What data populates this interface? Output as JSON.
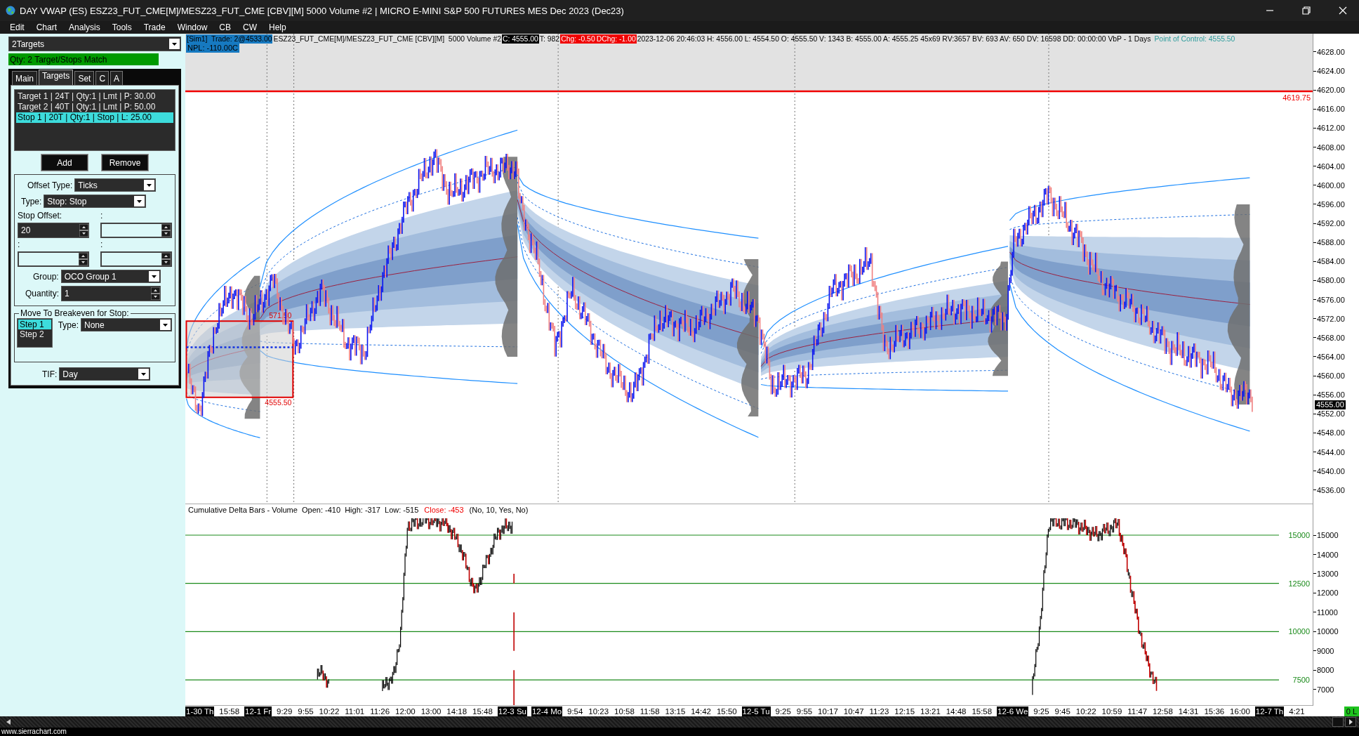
{
  "window": {
    "title": "DAY VWAP (ES) ESZ23_FUT_CME[M]/MESZ23_FUT_CME [CBV][M]  5000 Volume #2 | MICRO E-MINI S&P 500 FUTURES MES Dec 2023 (Dec23)"
  },
  "menu": [
    "Edit",
    "Chart",
    "Analysis",
    "Tools",
    "Trade",
    "Window",
    "CB",
    "CW",
    "Help"
  ],
  "order_panel": {
    "preset": "2Targets",
    "status": "Qty: 2 Target/Stops Match",
    "tabs": [
      {
        "label": "Main",
        "selected": false
      },
      {
        "label": "Targets",
        "selected": true
      },
      {
        "label": "Set",
        "selected": false
      },
      {
        "label": "C",
        "selected": false
      },
      {
        "label": "A",
        "selected": false
      }
    ],
    "orders": [
      {
        "text": "Target 1 | 24T | Qty:1 | Lmt | P: 30.00",
        "selected": false
      },
      {
        "text": "Target 2 | 40T | Qty:1 | Lmt | P: 50.00",
        "selected": false
      },
      {
        "text": "Stop 1 | 20T | Qty:1 | Stop | L: 25.00",
        "selected": true
      }
    ],
    "buttons": [
      "Add",
      "Remove"
    ],
    "offset_type": {
      "label": "Offset Type:",
      "value": "Ticks"
    },
    "type": {
      "label": "Type:",
      "value": "Stop: Stop"
    },
    "offset_fields": [
      {
        "label": "Stop Offset:",
        "value": "20",
        "disabled": false
      },
      {
        "label": ":",
        "disabled": true
      },
      {
        "label": ":",
        "disabled": true
      },
      {
        "label": ":",
        "disabled": true
      }
    ],
    "group": {
      "label": "Group:",
      "value": "OCO Group 1"
    },
    "quantity": {
      "label": "Quantity:",
      "value": "1"
    },
    "breakeven": {
      "title": "Move To Breakeven for Stop:",
      "steps": [
        {
          "label": "Step 1",
          "selected": true
        },
        {
          "label": "Step 2",
          "selected": false
        }
      ],
      "type_label": "Type:",
      "type_value": "None"
    },
    "tif": {
      "label": "TIF:",
      "value": "Day"
    }
  },
  "chart": {
    "header": [
      {
        "text": "[Sim1]  Trade: 2@4533.00",
        "kind": "trade"
      },
      {
        "text": "ESZ23_FUT_CME[M]/MESZ23_FUT_CME [CBV][M]  5000 Volume #2",
        "kind": "plain"
      },
      {
        "text": "C: 4555.00",
        "kind": "inverse"
      },
      {
        "text": "T: 982",
        "kind": "plain"
      },
      {
        "text": "Chg: -0.50",
        "kind": "alert"
      },
      {
        "text": "DChg: -1.00",
        "kind": "alert"
      },
      {
        "text": "2023-12-06 20:46:03 H: 4556.00 L: 4554.50 O: 4555.50 V: 1343 B: 4555.00 A: 4555.25 45x69 RV:3657 BV: 693 AV: 650 DV: 16598 DD: 00:00:00 VbP - 1 Days",
        "kind": "plain"
      },
      {
        "text": "Point of Control: 4555.50",
        "kind": "poc"
      }
    ],
    "npl": "NPL: -110.00C",
    "line_label": "4619.75",
    "box_labels": [
      "571.50",
      "4555.50"
    ],
    "price_axis": [
      "4628.00",
      "4624.00",
      "4620.00",
      "4616.00",
      "4612.00",
      "4608.00",
      "4604.00",
      "4600.00",
      "4596.00",
      "4592.00",
      "4588.00",
      "4584.00",
      "4580.00",
      "4576.00",
      "4572.00",
      "4568.00",
      "4564.00",
      "4560.00",
      "4556.00",
      "4552.00",
      "4548.00",
      "4544.00",
      "4540.00",
      "4536.00"
    ],
    "current_price": "4555.00"
  },
  "subchart": {
    "header": [
      {
        "text": "Cumulative Delta Bars - Volume  Open: -410  High: -317  Low: -515",
        "kind": "plain"
      },
      {
        "text": "Close: -453",
        "kind": "alert"
      },
      {
        "text": "(No, 10, Yes, No)",
        "kind": "plain"
      }
    ],
    "grid_labels": [
      "15000",
      "12500",
      "10000",
      "7500"
    ],
    "axis": [
      "15000",
      "14000",
      "13000",
      "12000",
      "11000",
      "10000",
      "9000",
      "8000",
      "7000"
    ]
  },
  "time_axis": [
    {
      "text": "1-30 Th",
      "kind": "date"
    },
    {
      "text": "15:58",
      "kind": "time"
    },
    {
      "text": "12-1 Fr",
      "kind": "date"
    },
    {
      "text": "9:29",
      "kind": "time"
    },
    {
      "text": "9:55",
      "kind": "time"
    },
    {
      "text": "10:22",
      "kind": "time"
    },
    {
      "text": "11:01",
      "kind": "time"
    },
    {
      "text": "11:26",
      "kind": "time"
    },
    {
      "text": "12:00",
      "kind": "time"
    },
    {
      "text": "13:00",
      "kind": "time"
    },
    {
      "text": "14:18",
      "kind": "time"
    },
    {
      "text": "15:48",
      "kind": "time"
    },
    {
      "text": "12-3 Su",
      "kind": "date"
    },
    {
      "text": "12-4 Mo",
      "kind": "date"
    },
    {
      "text": "9:54",
      "kind": "time"
    },
    {
      "text": "10:23",
      "kind": "time"
    },
    {
      "text": "10:58",
      "kind": "time"
    },
    {
      "text": "11:58",
      "kind": "time"
    },
    {
      "text": "13:15",
      "kind": "time"
    },
    {
      "text": "14:42",
      "kind": "time"
    },
    {
      "text": "15:50",
      "kind": "time"
    },
    {
      "text": "12-5 Tu",
      "kind": "date"
    },
    {
      "text": "9:25",
      "kind": "time"
    },
    {
      "text": "9:55",
      "kind": "time"
    },
    {
      "text": "10:17",
      "kind": "time"
    },
    {
      "text": "10:47",
      "kind": "time"
    },
    {
      "text": "11:23",
      "kind": "time"
    },
    {
      "text": "12:15",
      "kind": "time"
    },
    {
      "text": "13:21",
      "kind": "time"
    },
    {
      "text": "14:48",
      "kind": "time"
    },
    {
      "text": "15:58",
      "kind": "time"
    },
    {
      "text": "12-6 We",
      "kind": "date"
    },
    {
      "text": "9:25",
      "kind": "time"
    },
    {
      "text": "9:45",
      "kind": "time"
    },
    {
      "text": "10:22",
      "kind": "time"
    },
    {
      "text": "10:59",
      "kind": "time"
    },
    {
      "text": "11:47",
      "kind": "time"
    },
    {
      "text": "12:58",
      "kind": "time"
    },
    {
      "text": "14:31",
      "kind": "time"
    },
    {
      "text": "15:36",
      "kind": "time"
    },
    {
      "text": "16:00",
      "kind": "time"
    },
    {
      "text": "12-7 Th",
      "kind": "date"
    },
    {
      "text": "4:21",
      "kind": "time"
    }
  ],
  "position": "0 L",
  "footer": "www.sierrachart.com"
}
